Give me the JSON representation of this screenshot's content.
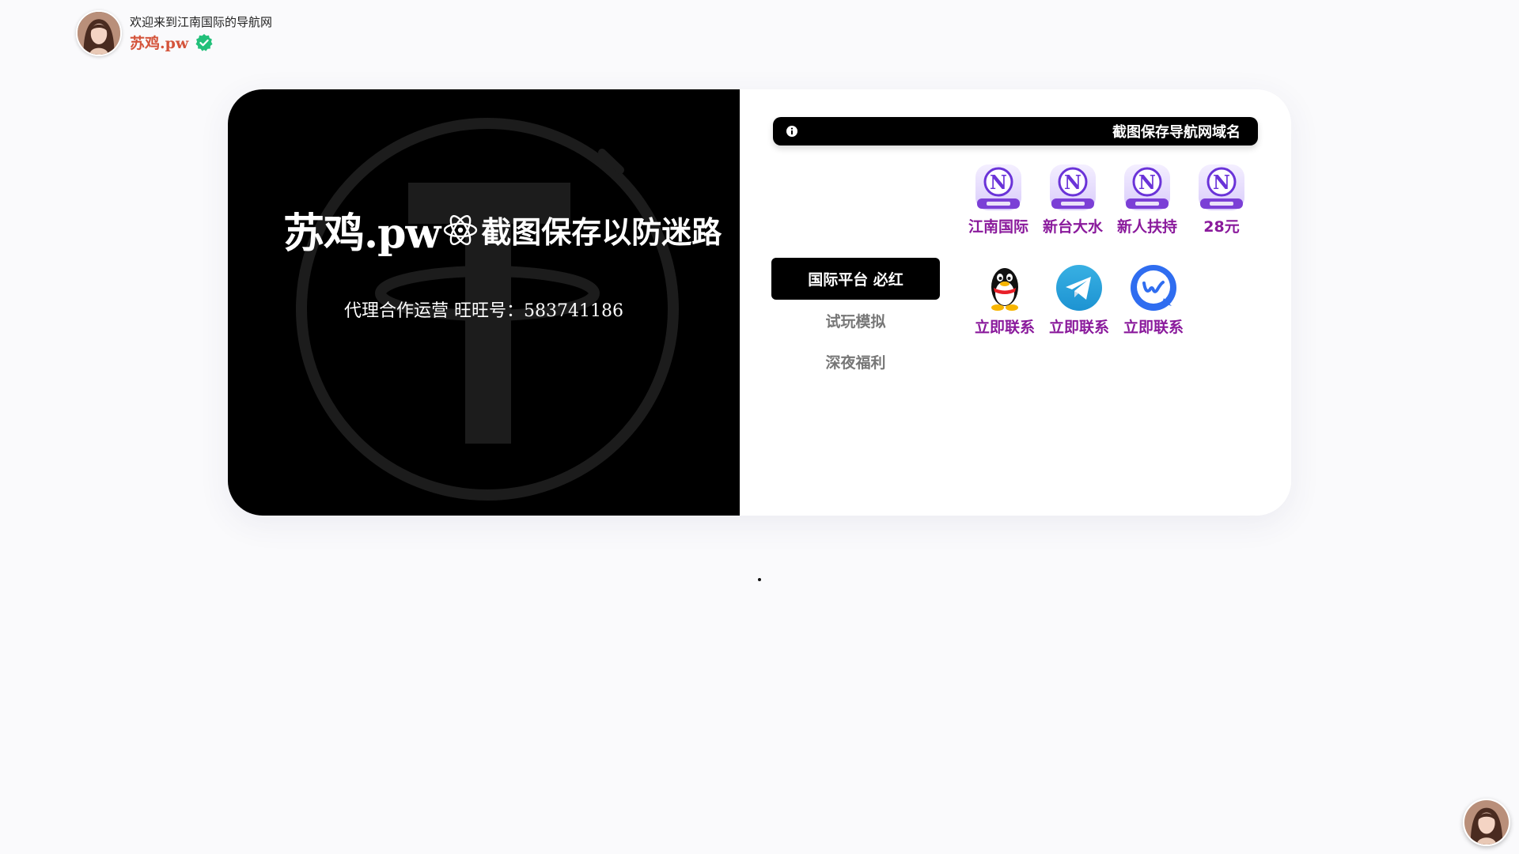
{
  "header": {
    "welcome": "欢迎来到江南国际的导航网",
    "brand": "苏鸡.pw",
    "verified_icon": "verified-check-icon",
    "brand_color": "#d4543b"
  },
  "hero": {
    "title_main": "苏鸡.pw",
    "title_icon": "atom-icon",
    "title_sub": "截图保存以防迷路",
    "contact": "代理合作运营 旺旺号：583741186",
    "background_icon": "tether-logo-icon"
  },
  "notice": {
    "icon": "info-icon",
    "text": "截图保存导航网域名"
  },
  "menu": {
    "items": [
      {
        "label": "国际平台 必红",
        "active": true
      },
      {
        "label": "试玩模拟",
        "active": false
      },
      {
        "label": "深夜福利",
        "active": false
      }
    ]
  },
  "apps": [
    {
      "label": "江南国际",
      "icon": "jiangnan-n-icon"
    },
    {
      "label": "新台大水",
      "icon": "jiangnan-n-icon"
    },
    {
      "label": "新人扶持",
      "icon": "jiangnan-n-icon"
    },
    {
      "label": "28元",
      "icon": "jiangnan-n-icon"
    }
  ],
  "contacts": [
    {
      "label": "立即联系",
      "icon": "qq-penguin-icon"
    },
    {
      "label": "立即联系",
      "icon": "telegram-icon"
    },
    {
      "label": "立即联系",
      "icon": "chat-w-icon"
    }
  ],
  "colors": {
    "app_label": "#8a1a9c",
    "accent_purple": "#7b3fd6",
    "telegram": "#2aa3df",
    "chat_blue": "#2f6df0"
  }
}
